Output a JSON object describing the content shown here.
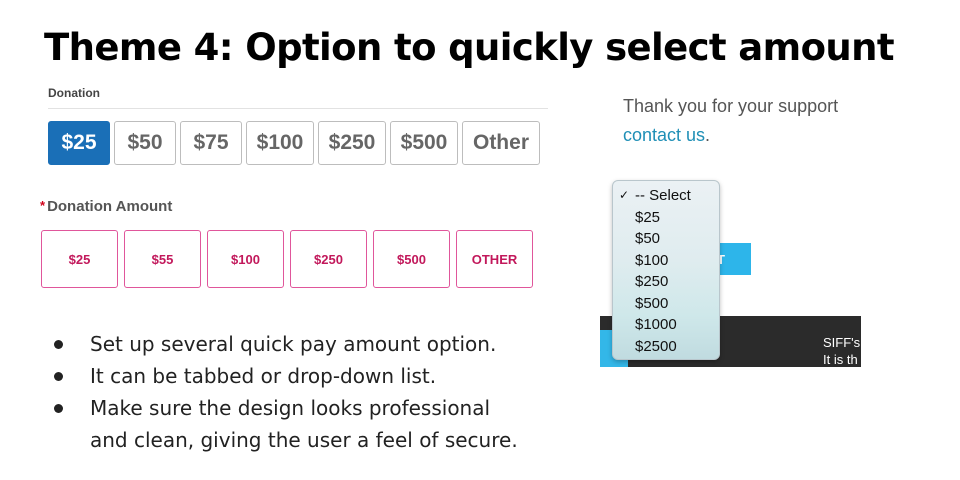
{
  "slide": {
    "title": "Theme 4: Option to quickly select amount"
  },
  "mock1": {
    "label": "Donation",
    "options": [
      "$25",
      "$50",
      "$75",
      "$100",
      "$250",
      "$500",
      "Other"
    ],
    "selected": "$25",
    "colors": {
      "active_bg": "#1a6fb7",
      "border": "#bdbdbd",
      "text": "#666666"
    }
  },
  "mock2": {
    "required_mark": "*",
    "label": "Donation Amount",
    "options": [
      "$25",
      "$55",
      "$100",
      "$250",
      "$500",
      "OTHER"
    ],
    "colors": {
      "border": "#e0569b",
      "text": "#c2185b"
    }
  },
  "bullets": [
    "Set up several quick pay amount option.",
    "It can be tabbed or drop-down list.",
    "Make sure the design looks professional",
    "and clean, giving the user a feel of secure."
  ],
  "screenshot": {
    "thanks_text": "Thank you for your support",
    "contact_link": "contact us",
    "contact_period": ".",
    "button_fragment": "T",
    "footer_line1": "SIFF's",
    "footer_line2": "It is th",
    "dropdown": {
      "options": [
        "-- Select",
        "$25",
        "$50",
        "$100",
        "$250",
        "$500",
        "$1000",
        "$2500"
      ],
      "selected": "-- Select",
      "check_glyph": "✓"
    },
    "colors": {
      "link": "#1f8fb6",
      "button": "#2db5ea",
      "band": "#2b2b2b"
    }
  }
}
